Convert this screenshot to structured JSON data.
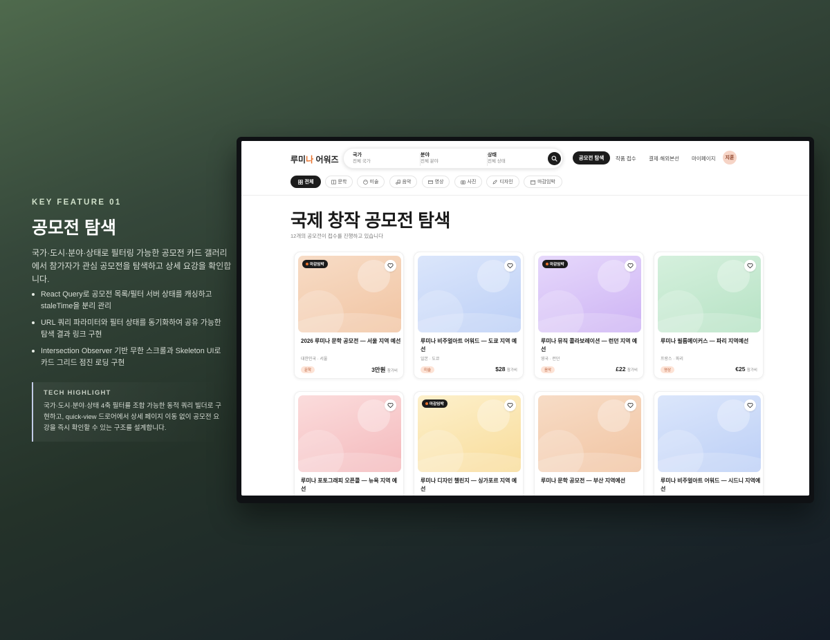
{
  "feature": {
    "label": "KEY FEATURE 01",
    "title": "공모전 탐색",
    "description": "국가·도시·분야·상태로 필터링 가능한 공모전 카드 갤러리에서 참가자가 관심 공모전을 탐색하고 상세 요강을 확인합니다.",
    "bullets": [
      "React Query로 공모전 목록/필터 서버 상태를 캐싱하고 staleTime을 분리 관리",
      "URL 쿼리 파라미터와 필터 상태를 동기화하여 공유 가능한 탐색 결과 링크 구현",
      "Intersection Observer 기반 무한 스크롤과 Skeleton UI로 카드 그리드 점진 로딩 구현"
    ],
    "highlight": {
      "title": "TECH HIGHLIGHT",
      "text": "국가·도시·분야·상태 4축 필터를 조합 가능한 동적 쿼리 빌더로 구현하고, quick-view 드로어에서 상세 페이지 이동 없이 공모전 요강을 즉시 확인할 수 있는 구조를 설계합니다."
    }
  },
  "app": {
    "logo_main": "루미",
    "logo_accent": "나",
    "logo_rest": " 어워즈",
    "search": {
      "country_label": "국가",
      "country_value": "전체 국가",
      "field_label": "분야",
      "field_value": "전체 분야",
      "status_label": "상태",
      "status_value": "전체 상태"
    },
    "nav": {
      "active": "공모전 탐색",
      "submit": "작품 접수",
      "payment": "결제·해외본선",
      "mypage": "마이페이지",
      "avatar": "지훈"
    },
    "categories": [
      "전체",
      "문학",
      "미술",
      "음악",
      "영상",
      "사진",
      "디자인",
      "마감임박"
    ],
    "page_title": "국제 창작 공모전 탐색",
    "page_sub": "12개의 공모전이 접수를 진행하고 있습니다",
    "badge_label": "마감임박",
    "price_unit": "참가비",
    "cards": [
      {
        "title": "2026 루미나 문학 공모전 — 서울 지역 예선",
        "location": "대한민국 · 서울",
        "tag": "문학",
        "price": "3만원",
        "badge": true,
        "gradient": [
          "#f7dcc6",
          "#f1c4a2"
        ],
        "tag_color": "#fde3d6"
      },
      {
        "title": "루미나 비주얼아트 어워드 — 도쿄 지역 예선",
        "location": "일본 · 도쿄",
        "tag": "미술",
        "price": "$28",
        "badge": false,
        "gradient": [
          "#dbe6fb",
          "#bccff6"
        ],
        "tag_color": "#fde3d6"
      },
      {
        "title": "루미나 뮤직 콜라보레이션 — 런던 지역 예선",
        "location": "영국 · 런던",
        "tag": "음악",
        "price": "£22",
        "badge": true,
        "gradient": [
          "#e6d8fb",
          "#cdb3f4"
        ],
        "tag_color": "#fde3d6"
      },
      {
        "title": "루미나 필름메이커스 — 파리 지역예선",
        "location": "프랑스 · 파리",
        "tag": "영상",
        "price": "€25",
        "badge": false,
        "gradient": [
          "#d5f0dd",
          "#b6e2c4"
        ],
        "tag_color": "#fde3d6"
      },
      {
        "title": "루미나 포토그래피 오픈콜 — 뉴욕 지역 예선",
        "location": "",
        "tag": "",
        "price": "",
        "badge": false,
        "gradient": [
          "#fbdcdc",
          "#f4b9bc"
        ],
        "tag_color": "#fde3d6"
      },
      {
        "title": "루미나 디자인 챌린지 — 싱가포르 지역 예선",
        "location": "",
        "tag": "",
        "price": "",
        "badge": true,
        "gradient": [
          "#fdf0cb",
          "#f8dc9a"
        ],
        "tag_color": "#fde3d6"
      },
      {
        "title": "루미나 문학 공모전 — 부산 지역예선",
        "location": "대한민국 · 부산",
        "tag": "",
        "price": "",
        "badge": false,
        "gradient": [
          "#f7dcc6",
          "#f1c4a2"
        ],
        "tag_color": "#fde3d6"
      },
      {
        "title": "루미나 비주얼아트 어워드 — 시드니 지역예선",
        "location": "",
        "tag": "",
        "price": "",
        "badge": false,
        "gradient": [
          "#dbe6fb",
          "#bccff6"
        ],
        "tag_color": "#fde3d6"
      }
    ]
  }
}
